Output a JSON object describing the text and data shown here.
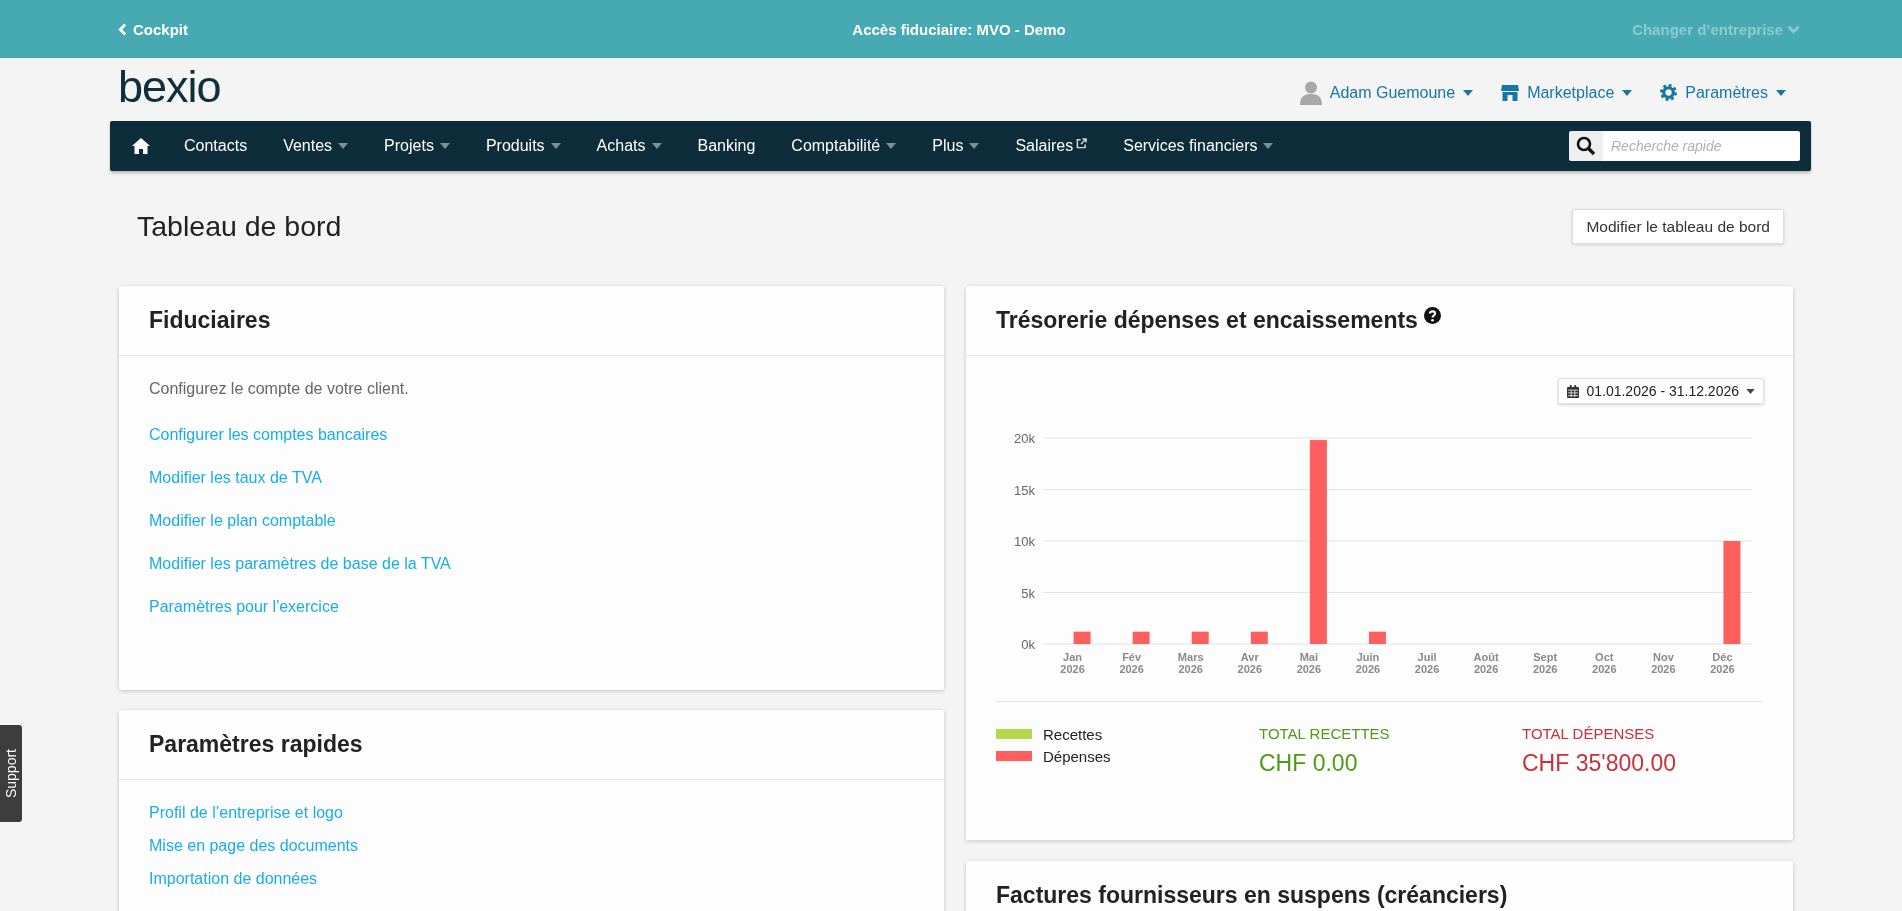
{
  "top_bar": {
    "back_link": "Cockpit",
    "title": "Accès fiduciaire: MVO - Demo",
    "company_switch": {
      "label": "Changer d’entreprise",
      "disabled": true
    }
  },
  "header": {
    "logo": "bexio",
    "menus": [
      {
        "kind": "profile",
        "label": "Adam Guemoune"
      },
      {
        "kind": "shop",
        "label": "Marketplace"
      },
      {
        "kind": "settings",
        "label": "Paramètres"
      }
    ]
  },
  "nav": {
    "items": [
      {
        "kind": "home"
      },
      {
        "kind": "link",
        "label": "Contacts"
      },
      {
        "kind": "dropdown",
        "label": "Ventes"
      },
      {
        "kind": "dropdown",
        "label": "Projets"
      },
      {
        "kind": "dropdown",
        "label": "Produits"
      },
      {
        "kind": "dropdown",
        "label": "Achats"
      },
      {
        "kind": "link",
        "label": "Banking"
      },
      {
        "kind": "dropdown",
        "label": "Comptabilité"
      },
      {
        "kind": "dropdown",
        "label": "Plus"
      },
      {
        "kind": "external",
        "label": "Salaires"
      },
      {
        "kind": "dropdown",
        "label": "Services financiers"
      }
    ],
    "search": {
      "placeholder": "Recherche rapide"
    }
  },
  "page": {
    "title": "Tableau de bord",
    "edit_button": "Modifier le tableau de bord"
  },
  "left_cards": [
    {
      "title": "Fiduciaires",
      "intro": "Configurez le compte de votre client.",
      "links": [
        "Configurer les comptes bancaires",
        "Modifier les taux de TVA",
        "Modifier le plan comptable",
        "Modifier les paramètres de base de la TVA",
        "Paramètres pour l'exercice"
      ]
    },
    {
      "title": "Paramètres rapides",
      "links": [
        "Profil de l’entreprise et logo",
        "Mise en page des documents",
        "Importation de données"
      ]
    }
  ],
  "treasury": {
    "title": "Trésorerie dépenses et encaissements",
    "date_range": "01.01.2026 - 31.12.2026",
    "chart_data": {
      "type": "bar",
      "grid": true,
      "categories": [
        "Jan 2026",
        "Fév 2026",
        "Mars 2026",
        "Avr 2026",
        "Mai 2026",
        "Juin 2026",
        "Juil 2026",
        "Août 2026",
        "Sept 2026",
        "Oct 2026",
        "Nov 2026",
        "Déc 2026"
      ],
      "series": [
        {
          "name": "Recettes",
          "color": "#b4d84a",
          "values": [
            0,
            0,
            0,
            0,
            0,
            0,
            0,
            0,
            0,
            0,
            0,
            0
          ]
        },
        {
          "name": "Dépenses",
          "color": "#ff5f5f",
          "values": [
            1200,
            1200,
            1200,
            1200,
            19800,
            1200,
            0,
            0,
            0,
            0,
            0,
            10000
          ]
        }
      ],
      "ylim": [
        0,
        20000
      ],
      "yticks": [
        {
          "value": 0,
          "label": "0k"
        },
        {
          "value": 5000,
          "label": "5k"
        },
        {
          "value": 10000,
          "label": "10k"
        },
        {
          "value": 15000,
          "label": "15k"
        },
        {
          "value": 20000,
          "label": "20k"
        }
      ]
    },
    "totals": [
      {
        "label": "TOTAL RECETTES",
        "value": "CHF 0.00",
        "color": "#4f9a14"
      },
      {
        "label": "TOTAL DÉPENSES",
        "value": "CHF 35'800.00",
        "color": "#c9303a"
      }
    ]
  },
  "payables": {
    "title": "Factures fournisseurs en suspens (créanciers)"
  },
  "support_tab": {
    "label": "Support"
  }
}
